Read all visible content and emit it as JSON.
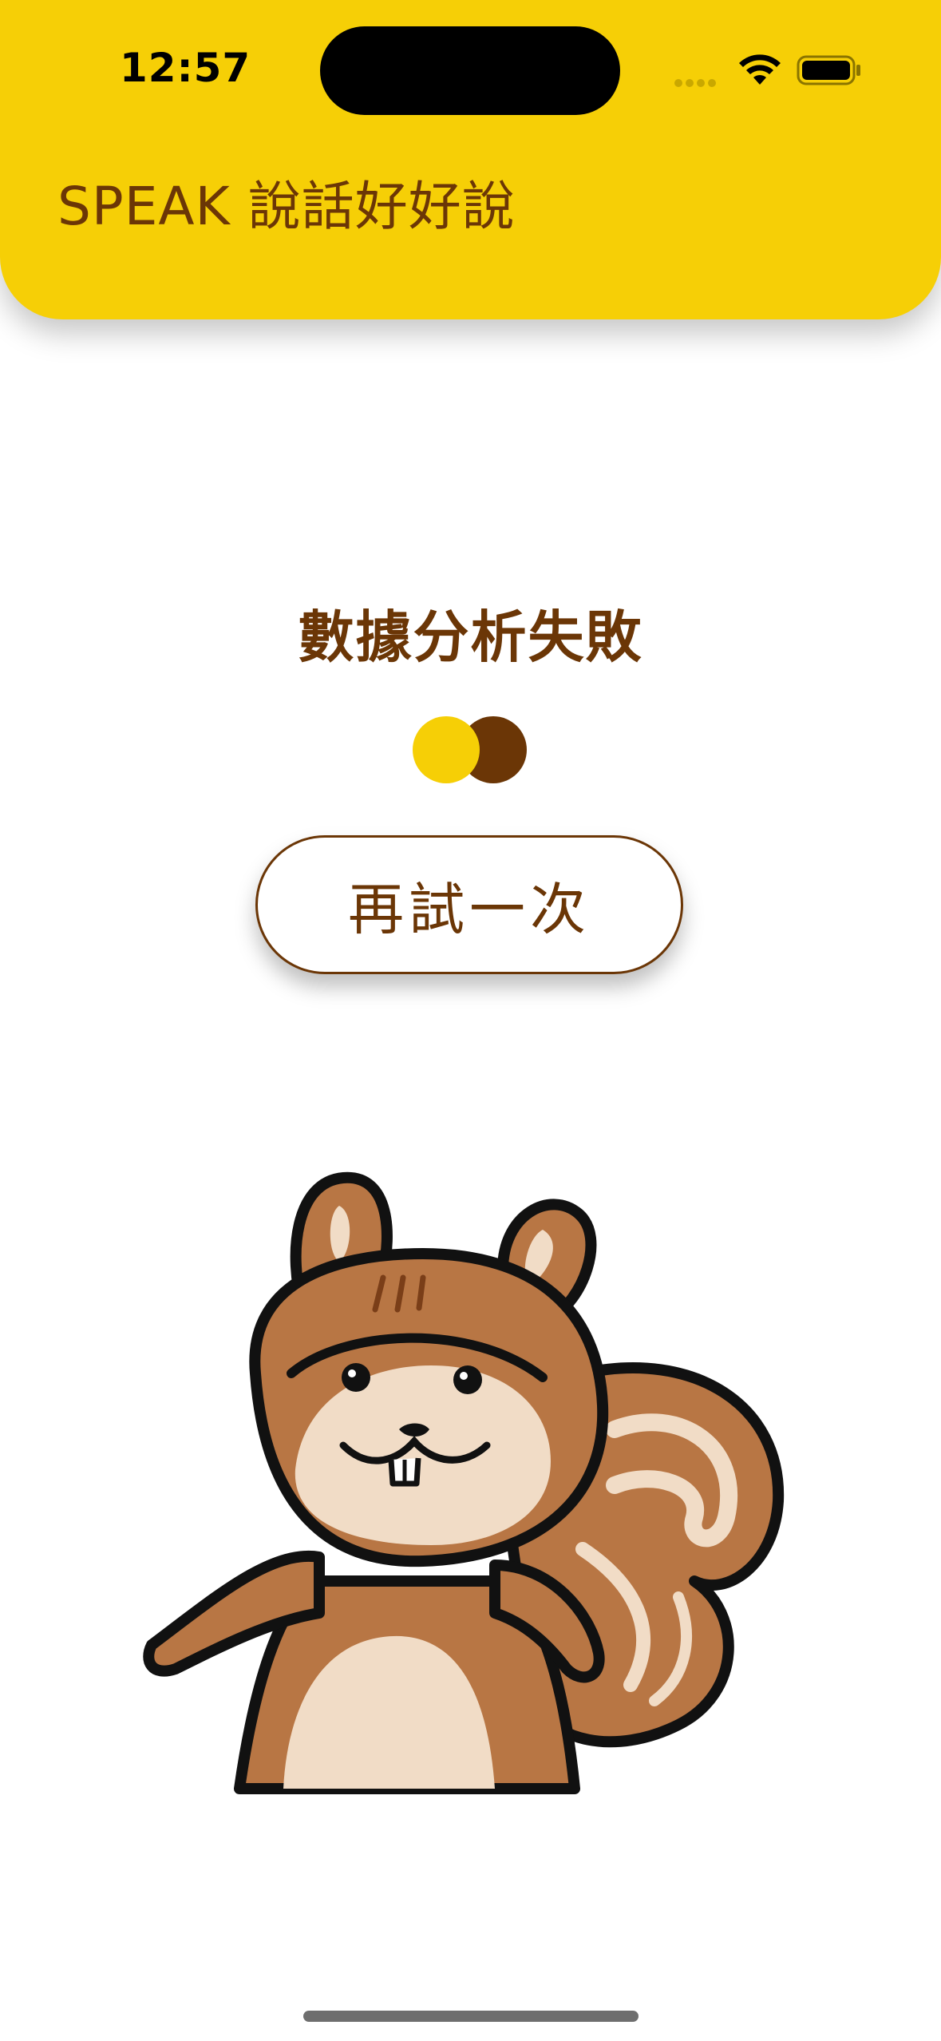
{
  "status_bar": {
    "time": "12:57"
  },
  "header": {
    "title": "SPEAK 說話好好說"
  },
  "main": {
    "message": "數據分析失敗",
    "retry_label": "再試一次"
  },
  "colors": {
    "brand_yellow": "#F6CF06",
    "brand_brown": "#6B3606"
  },
  "icons": {
    "wifi": "wifi-icon",
    "battery": "battery-icon",
    "mascot": "squirrel-illustration"
  }
}
